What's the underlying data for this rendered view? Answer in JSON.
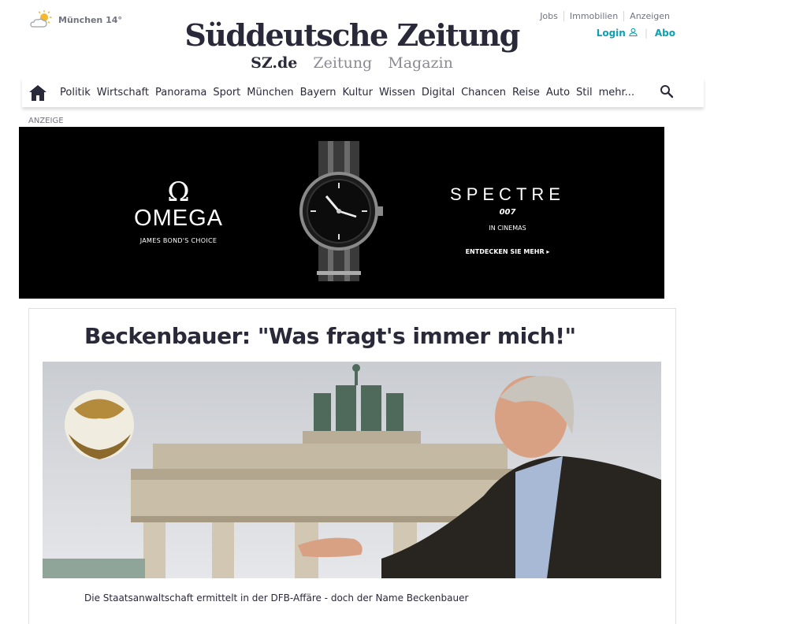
{
  "weather": {
    "icon": "sun-cloud-icon",
    "text": "München 14°"
  },
  "logo": "Süddeutsche Zeitung",
  "sublinks": [
    "SZ.de",
    "Zeitung",
    "Magazin"
  ],
  "service_links": [
    "Jobs",
    "Immobilien",
    "Anzeigen"
  ],
  "account": {
    "login": "Login",
    "abo": "Abo",
    "accent_color": "#09a1b4"
  },
  "nav": {
    "items": [
      "Politik",
      "Wirtschaft",
      "Panorama",
      "Sport",
      "München",
      "Bayern",
      "Kultur",
      "Wissen",
      "Digital",
      "Chancen",
      "Reise",
      "Auto",
      "Stil",
      "mehr..."
    ]
  },
  "ad": {
    "label": "ANZEIGE",
    "brand_symbol": "Ω",
    "brand": "OMEGA",
    "brand_tagline": "JAMES BOND'S CHOICE",
    "film": "SPECTRE",
    "film_logo": "007",
    "cinemas": "IN CINEMAS",
    "cta": "ENTDECKEN SIE MEHR ▸"
  },
  "article": {
    "headline": "Beckenbauer: \"Was fragt's immer mich!\"",
    "summary": "Die Staatsanwaltschaft ermittelt in der DFB-Affäre - doch der Name Beckenbauer"
  }
}
